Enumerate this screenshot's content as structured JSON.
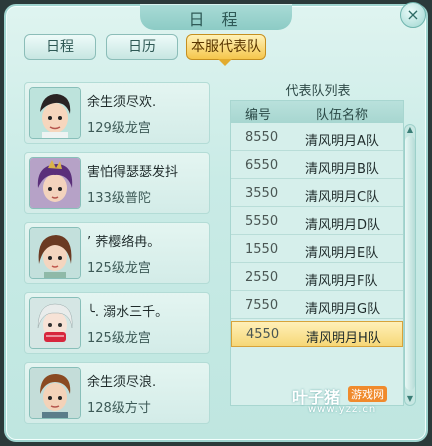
{
  "window": {
    "title": "日 程",
    "close_label": "×"
  },
  "tabs": [
    {
      "label": "日程",
      "active": false
    },
    {
      "label": "日历",
      "active": false
    },
    {
      "label": "本服代表队",
      "active": true
    }
  ],
  "players": [
    {
      "name": "余生须尽欢.",
      "level": "129级龙宫"
    },
    {
      "name": "害怕得瑟瑟发抖",
      "level": "133级普陀"
    },
    {
      "name": "’ 荞樱络冉。",
      "level": "125级龙宫"
    },
    {
      "name": "╰. 溺水三千。",
      "level": "125级龙宫"
    },
    {
      "name": "余生须尽浪.",
      "level": "128级方寸"
    }
  ],
  "team_list": {
    "title": "代表队列表",
    "columns": [
      "编号",
      "队伍名称"
    ],
    "rows": [
      {
        "id": "8550",
        "name": "清风明月A队",
        "selected": false
      },
      {
        "id": "6550",
        "name": "清风明月B队",
        "selected": false
      },
      {
        "id": "3550",
        "name": "清风明月C队",
        "selected": false
      },
      {
        "id": "5550",
        "name": "清风明月D队",
        "selected": false
      },
      {
        "id": "1550",
        "name": "清风明月E队",
        "selected": false
      },
      {
        "id": "2550",
        "name": "清风明月F队",
        "selected": false
      },
      {
        "id": "7550",
        "name": "清风明月G队",
        "selected": false
      },
      {
        "id": "4550",
        "name": "清风明月H队",
        "selected": true
      }
    ]
  },
  "watermark": {
    "brand": "叶子猪",
    "tag": "游戏网",
    "url": "www.yzz.cn"
  },
  "colors": {
    "panel_bg": "#c9ebe6",
    "tab_active": "#f5c64c",
    "row_selected": "#f6d777"
  }
}
